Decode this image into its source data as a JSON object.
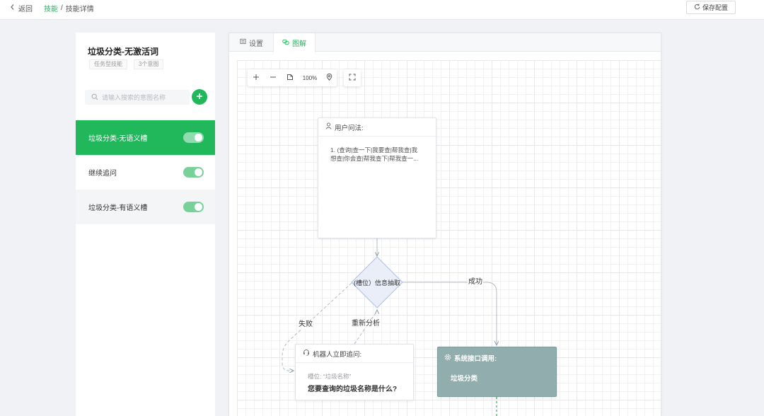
{
  "topbar": {
    "back_icon": "chevron-left-icon",
    "back_label": "返回",
    "breadcrumb": [
      "技能",
      "技能详情"
    ],
    "breadcrumb_separator": "/",
    "save_icon": "refresh-icon",
    "save_label": "保存配置"
  },
  "sidebar": {
    "title": "垃圾分类-无激活词",
    "tags": [
      "任务型技能",
      "3个意图"
    ],
    "search": {
      "placeholder": "请输入搜索的意图名称",
      "value": "",
      "icon": "search-icon"
    },
    "add_icon": "plus-icon",
    "intents": [
      {
        "label": "垃圾分类-无语义槽",
        "enabled": true,
        "selected": true
      },
      {
        "label": "继续追问",
        "enabled": true,
        "selected": false
      },
      {
        "label": "垃圾分类-有语义槽",
        "enabled": true,
        "selected": false
      }
    ]
  },
  "tabs": [
    {
      "label": "设置",
      "icon": "settings-icon",
      "active": false
    },
    {
      "label": "图解",
      "icon": "diagram-icon",
      "active": true
    }
  ],
  "canvas_toolbar": {
    "zoom": "100%",
    "buttons": [
      "zoom-in-icon",
      "zoom-out-icon",
      "fit-view-icon",
      "locate-icon",
      "fullscreen-icon"
    ]
  },
  "flow": {
    "nodes": [
      {
        "header": "用户问法:",
        "icon": "user-icon",
        "lines": [
          "1. (查询|查一下|我要查|帮我查|我想查|你会查|帮我查下|帮我查一..."
        ]
      },
      {
        "label": "(槽位）信息抽取"
      },
      {
        "header": "机器人立即追问:",
        "icon": "headset-icon",
        "slot": "槽位: “垃圾名称”",
        "question": "您要查询的垃圾名称是什么?"
      },
      {
        "header": "系统接口调用:",
        "icon": "gear-icon",
        "body": "垃圾分类"
      }
    ],
    "edges": [
      {
        "from": 0,
        "to": 1,
        "dashed": false
      },
      {
        "from": 1,
        "to": 3,
        "label": "成功",
        "dashed": false
      },
      {
        "from": 1,
        "to": 2,
        "label": "失败",
        "dashed": true
      },
      {
        "from": 2,
        "to": 1,
        "label": "重新分析",
        "dashed": true
      }
    ]
  },
  "colors": {
    "accent": "#21b85c",
    "api_node": "#91adad",
    "decision_fill": "#e9eef9",
    "decision_stroke": "#aebfe4"
  }
}
